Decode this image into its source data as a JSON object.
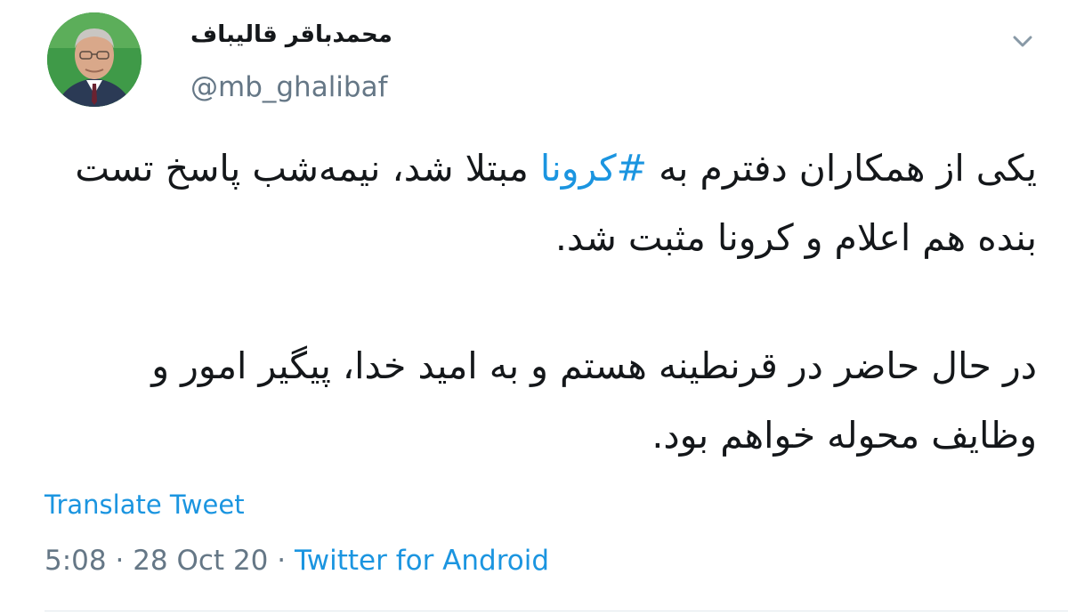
{
  "user": {
    "display_name": "محمدباقر قالیباف",
    "handle": "@mb_ghalibaf"
  },
  "tweet": {
    "line1_a": "یکی از همکاران دفترم به ",
    "hashtag": "#کرونا",
    "line1_b": " مبتلا شد، نیمه‌شب پاسخ تست بنده هم اعلام و کرونا مثبت شد.",
    "paragraph2": "در حال حاضر در قرنطینه هستم و به امید خدا، پیگیر امور و وظایف محوله خواهم بود."
  },
  "translate_label": "Translate Tweet",
  "meta": {
    "time": "5:08",
    "sep1": " · ",
    "date": "28 Oct 20",
    "sep2": " · ",
    "source": "Twitter for Android"
  },
  "colors": {
    "link": "#1b95e0",
    "secondary_text": "#657786",
    "primary_text": "#14171a"
  },
  "icons": {
    "avatar": "profile-photo",
    "caret": "chevron-down-icon"
  }
}
